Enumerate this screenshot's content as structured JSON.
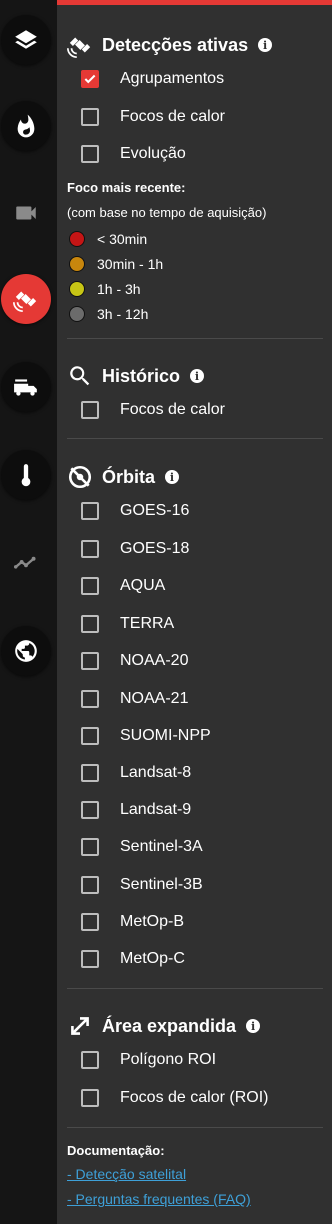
{
  "rail": {
    "buttons": [
      {
        "name": "layers-icon",
        "active": false
      },
      {
        "name": "fire-icon",
        "active": false
      },
      {
        "name": "camera-icon",
        "active": false
      },
      {
        "name": "satellite-icon",
        "active": true
      },
      {
        "name": "fire-truck-icon",
        "active": false
      },
      {
        "name": "thermometer-icon",
        "active": false
      },
      {
        "name": "line-chart-icon",
        "active": false
      },
      {
        "name": "globe-icon",
        "active": false
      }
    ]
  },
  "colors": {
    "accent": "#e53935",
    "link": "#3ea0d8"
  },
  "deteccoes": {
    "title": "Detecções ativas",
    "icon": "satellite-icon",
    "options": [
      {
        "label": "Agrupamentos",
        "checked": true
      },
      {
        "label": "Focos de calor",
        "checked": false
      },
      {
        "label": "Evolução",
        "checked": false
      }
    ],
    "legend_title": "Foco mais recente:",
    "legend_subtitle": "(com base no tempo de aquisição)",
    "legend": [
      {
        "label": "< 30min",
        "color": "#c41515"
      },
      {
        "label": "30min - 1h",
        "color": "#c8860d"
      },
      {
        "label": "1h - 3h",
        "color": "#c7c515"
      },
      {
        "label": "3h - 12h",
        "color": "#6b6b6b"
      }
    ]
  },
  "historico": {
    "title": "Histórico",
    "icon": "search-icon",
    "options": [
      {
        "label": "Focos de calor",
        "checked": false
      }
    ]
  },
  "orbita": {
    "title": "Órbita",
    "icon": "orbit-off-icon",
    "options": [
      {
        "label": "GOES-16",
        "checked": false
      },
      {
        "label": "GOES-18",
        "checked": false
      },
      {
        "label": "AQUA",
        "checked": false
      },
      {
        "label": "TERRA",
        "checked": false
      },
      {
        "label": "NOAA-20",
        "checked": false
      },
      {
        "label": "NOAA-21",
        "checked": false
      },
      {
        "label": "SUOMI-NPP",
        "checked": false
      },
      {
        "label": "Landsat-8",
        "checked": false
      },
      {
        "label": "Landsat-9",
        "checked": false
      },
      {
        "label": "Sentinel-3A",
        "checked": false
      },
      {
        "label": "Sentinel-3B",
        "checked": false
      },
      {
        "label": "MetOp-B",
        "checked": false
      },
      {
        "label": "MetOp-C",
        "checked": false
      }
    ]
  },
  "area": {
    "title": "Área expandida",
    "icon": "expand-icon",
    "options": [
      {
        "label": "Polígono ROI",
        "checked": false
      },
      {
        "label": "Focos de calor (ROI)",
        "checked": false
      }
    ]
  },
  "documentacao": {
    "title": "Documentação:",
    "links": [
      "- Detecção satelital",
      "- Perguntas frequentes (FAQ)"
    ]
  }
}
